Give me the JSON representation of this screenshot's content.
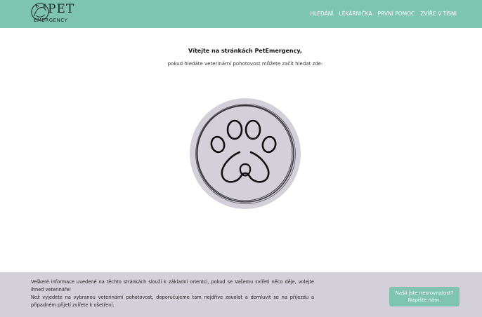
{
  "brand": {
    "logo_top": "PET",
    "logo_bottom": "EMERGENCY"
  },
  "nav": {
    "items": [
      {
        "label": "HLEDÁNÍ"
      },
      {
        "label": "LÉKÁRNIČKA"
      },
      {
        "label": "PRVNÍ POMOC"
      },
      {
        "label": "ZVÍŘE V TÍSNI"
      }
    ]
  },
  "main": {
    "title": "Vítejte na stránkách PetEmergency,",
    "subtitle": "pokud hledáte veterinární pohotovost můžete začít hledat zde:"
  },
  "paw": {
    "icon": "paw-icon",
    "circle_color": "#d3d0d9",
    "line_color": "#111111"
  },
  "footer": {
    "paragraph1": "Veškeré informace uvedené na těchto stránkách slouží k základní orientci, pokud se Vašemu zvířeti něco děje, volejte ihned veterináře!",
    "paragraph2": "Než vyjedete na vybranou veterinární pohotovost, doporučujeme tam nejdříve zavolat a domluvit se na příjezdu a případném přijetí zvířete k ošetření.",
    "contact_line1": "Našli jste nesrovnalost?",
    "contact_line2": "Napište nám."
  },
  "colors": {
    "accent": "#7ec4b0",
    "footer_bg": "#d4d0da"
  }
}
